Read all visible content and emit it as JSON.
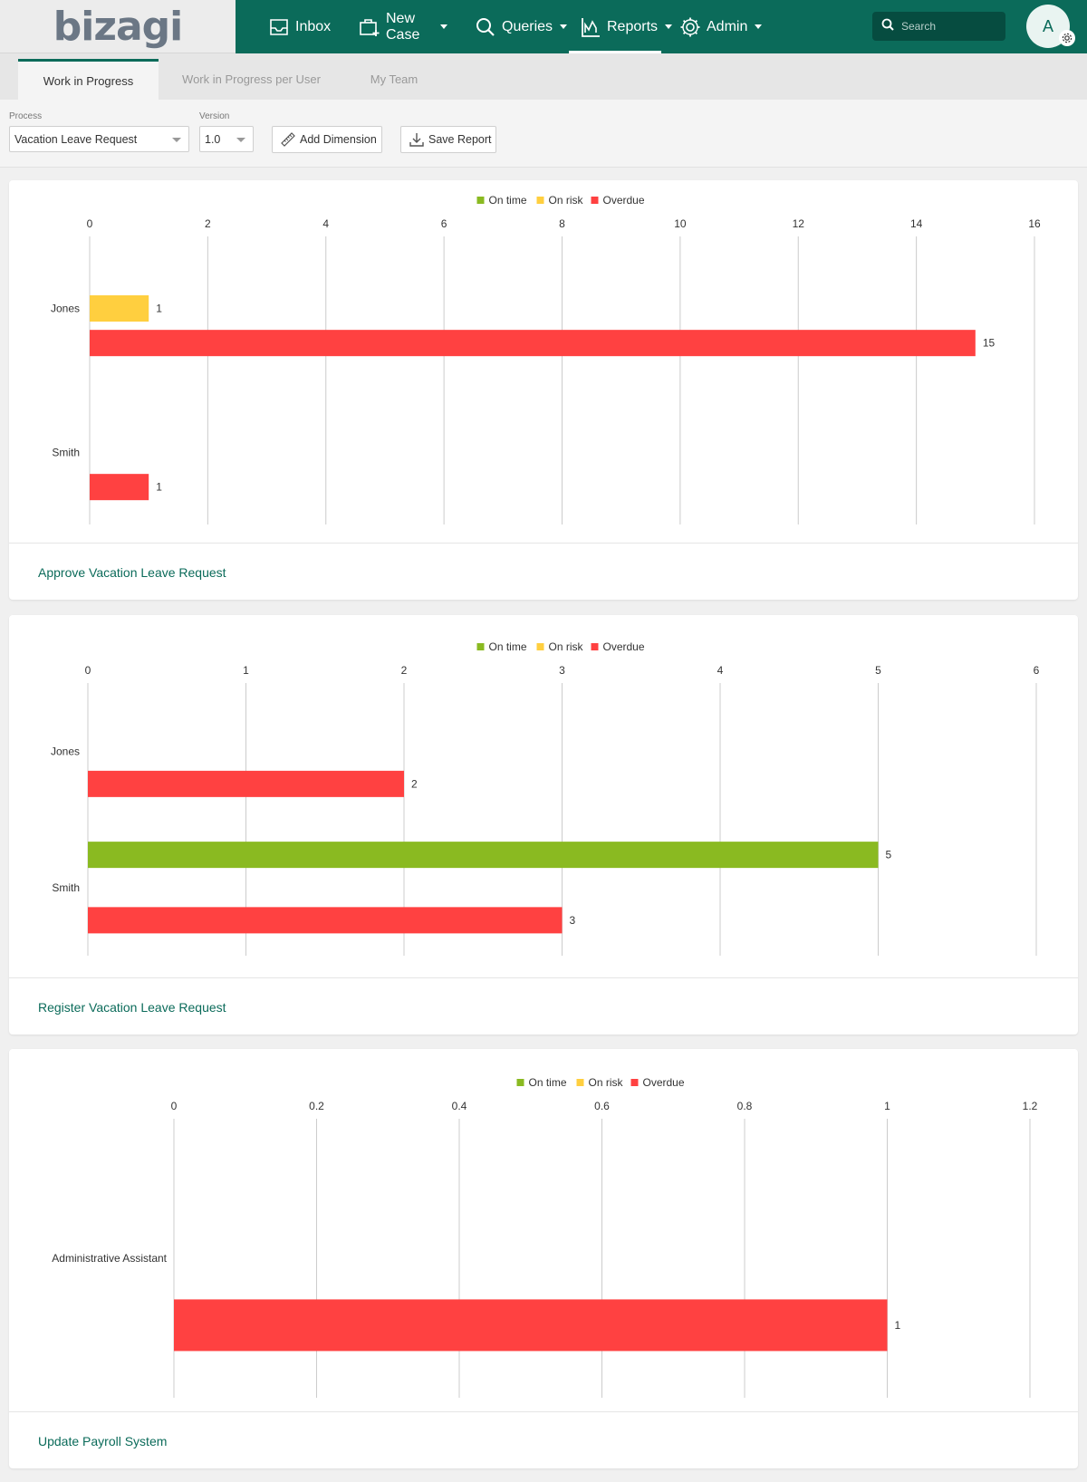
{
  "app": {
    "logo": "bizagi"
  },
  "nav": {
    "items": [
      {
        "label": "Inbox",
        "icon": "inbox-icon"
      },
      {
        "label": "New Case",
        "icon": "new-case-icon"
      },
      {
        "label": "Queries",
        "icon": "search-icon"
      },
      {
        "label": "Reports",
        "icon": "reports-chart-icon"
      },
      {
        "label": "Admin",
        "icon": "gear-icon"
      }
    ],
    "active": "Reports"
  },
  "search": {
    "placeholder": "Search"
  },
  "user": {
    "avatar_letter": "A"
  },
  "tabs": [
    {
      "label": "Work in Progress",
      "active": true
    },
    {
      "label": "Work in Progress per User",
      "active": false
    },
    {
      "label": "My Team",
      "active": false
    }
  ],
  "filters": {
    "process_label": "Process",
    "process_value": "Vacation Leave Request",
    "version_label": "Version",
    "version_value": "1.0",
    "add_dimension_label": "Add Dimension",
    "save_report_label": "Save Report"
  },
  "colors": {
    "brand": "#0b6b5a",
    "on_time": "#8aba21",
    "on_risk": "#ffcf3f",
    "overdue": "#ff4141"
  },
  "cards": [
    {
      "title": "Approve Vacation Leave Request"
    },
    {
      "title": "Register Vacation Leave Request"
    },
    {
      "title": "Update Payroll System"
    }
  ],
  "chart_data": [
    {
      "type": "bar",
      "orientation": "horizontal",
      "categories": [
        "Jones",
        "Smith"
      ],
      "series": [
        {
          "name": "On time",
          "values": [
            0,
            0
          ]
        },
        {
          "name": "On risk",
          "values": [
            1,
            0
          ]
        },
        {
          "name": "Overdue",
          "values": [
            15,
            1
          ]
        }
      ],
      "xlim": [
        0,
        16
      ],
      "ticks": [
        "0",
        "2",
        "4",
        "6",
        "8",
        "10",
        "12",
        "14",
        "16"
      ],
      "legend": "top-center",
      "grid": true
    },
    {
      "type": "bar",
      "orientation": "horizontal",
      "categories": [
        "Jones",
        "Smith"
      ],
      "series": [
        {
          "name": "On time",
          "values": [
            0,
            5
          ]
        },
        {
          "name": "On risk",
          "values": [
            0,
            0
          ]
        },
        {
          "name": "Overdue",
          "values": [
            2,
            3
          ]
        }
      ],
      "xlim": [
        0,
        6
      ],
      "ticks": [
        "0",
        "1",
        "2",
        "3",
        "4",
        "5",
        "6"
      ],
      "legend": "top-center",
      "grid": true
    },
    {
      "type": "bar",
      "orientation": "horizontal",
      "categories": [
        "Administrative Assistant"
      ],
      "series": [
        {
          "name": "On time",
          "values": [
            0
          ]
        },
        {
          "name": "On risk",
          "values": [
            0
          ]
        },
        {
          "name": "Overdue",
          "values": [
            1
          ]
        }
      ],
      "xlim": [
        0,
        1.2
      ],
      "ticks": [
        "0",
        "0.2",
        "0.4",
        "0.6",
        "0.8",
        "1",
        "1.2"
      ],
      "legend": "top-center",
      "grid": true
    }
  ]
}
